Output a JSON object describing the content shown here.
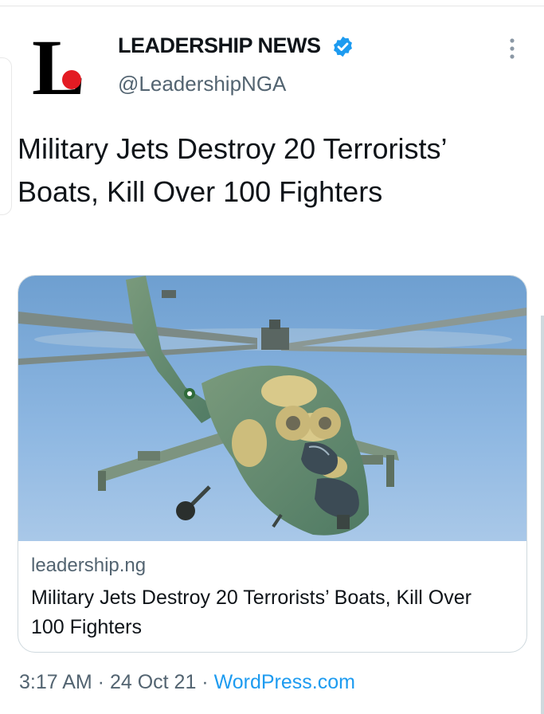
{
  "account": {
    "name": "LEADERSHIP NEWS",
    "handle": "@LeadershipNGA",
    "logo_letter": "L",
    "verified": true
  },
  "tweet": {
    "text": "Military Jets Destroy 20 Terrorists’ Boats, Kill Over 100 Fighters"
  },
  "card": {
    "domain": "leadership.ng",
    "title": "Military Jets Destroy 20 Terrorists’ Boats, Kill Over 100 Fighters",
    "image": "attack helicopter in green and tan camouflage flying against a blue sky"
  },
  "meta": {
    "time": "3:17 AM",
    "separator": " · ",
    "date": "24 Oct 21",
    "source": "WordPress.com"
  },
  "colors": {
    "text": "#0f1419",
    "secondary": "#536471",
    "link": "#1d9bf0",
    "verified": "#1d9bf0",
    "logo_dot": "#e31b23",
    "border": "#cfd9de"
  },
  "icons": [
    "verified-badge-icon",
    "more-options-icon"
  ]
}
